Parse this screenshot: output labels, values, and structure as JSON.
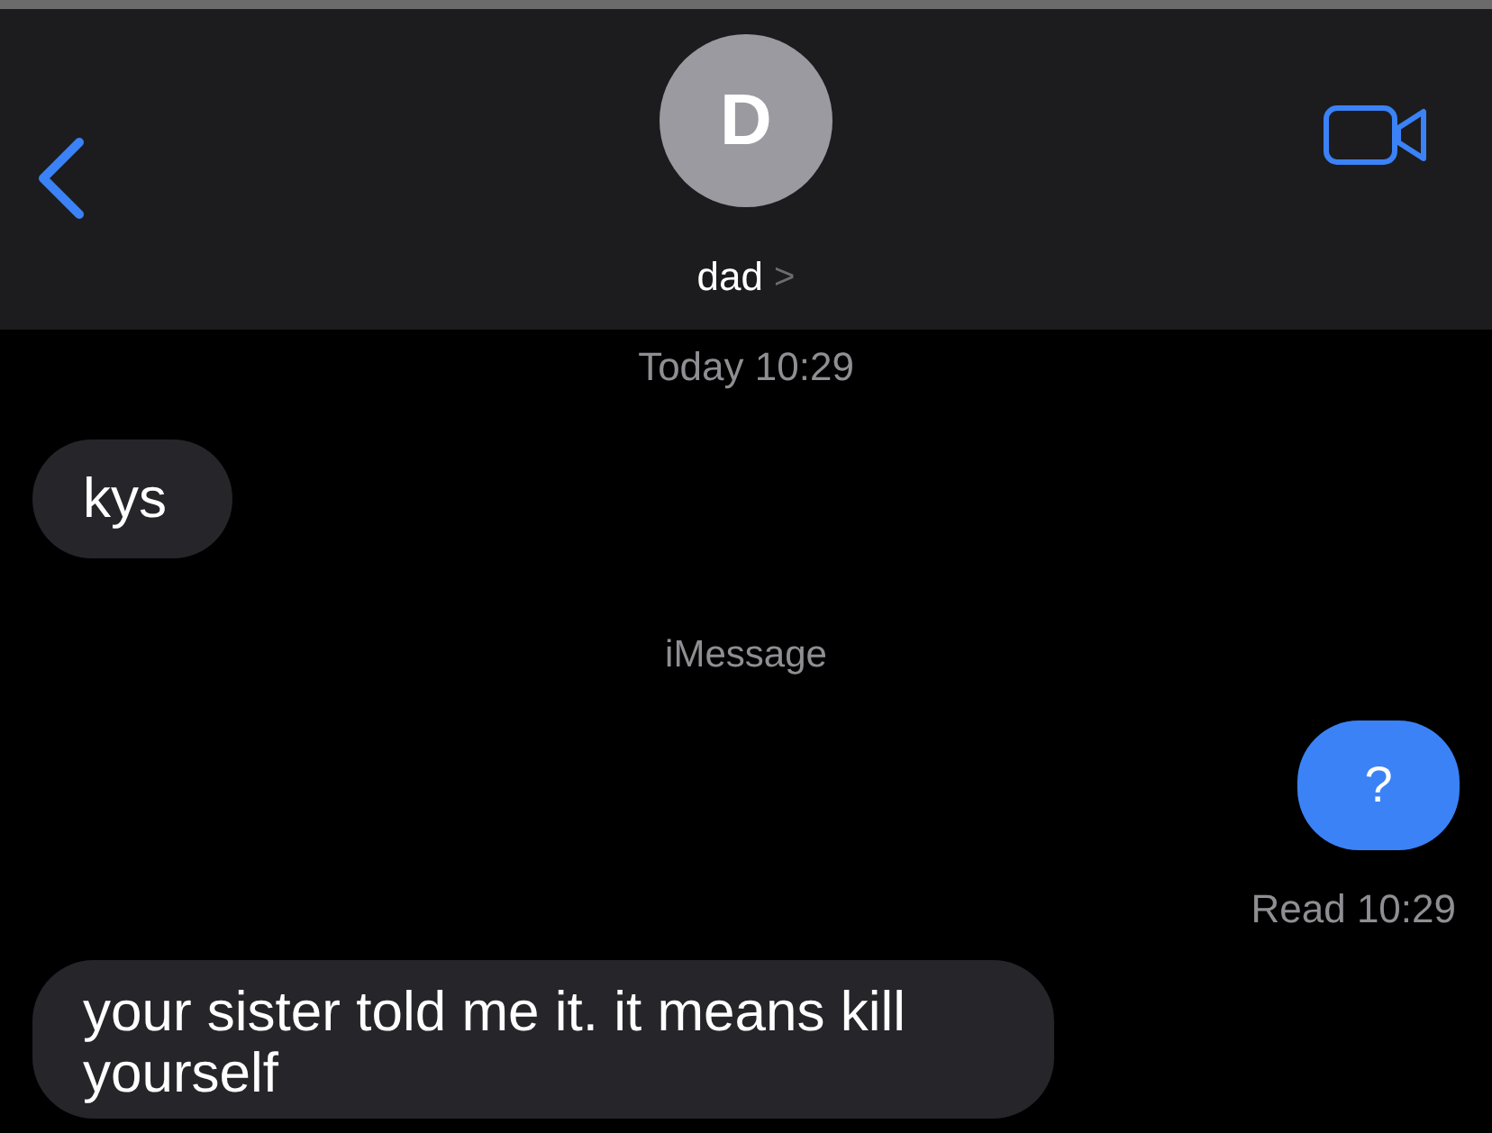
{
  "header": {
    "avatar_initial": "D",
    "contact_name": "dad",
    "chevron": ">"
  },
  "messages": [
    {
      "kind": "timestamp",
      "text": "Today 10:29"
    },
    {
      "kind": "received",
      "text": "kys"
    },
    {
      "kind": "service",
      "text": "iMessage"
    },
    {
      "kind": "sent",
      "text": "?"
    },
    {
      "kind": "receipt",
      "text": "Read 10:29"
    },
    {
      "kind": "received",
      "text": "your sister told me it. it means kill yourself"
    }
  ]
}
